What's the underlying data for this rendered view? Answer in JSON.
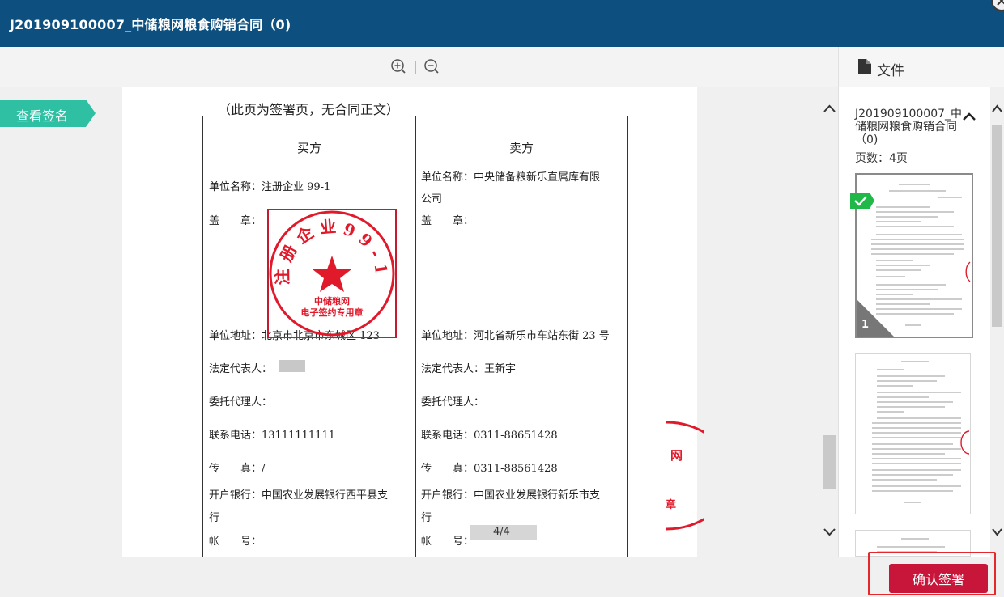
{
  "window": {
    "title": "J201909100007_中储粮网粮食购销合同（0)"
  },
  "toolbar": {
    "zoom_in_icon": "zoom-in-icon",
    "separator": "|",
    "zoom_out_icon": "zoom-out-icon"
  },
  "left_tag": {
    "label": "查看签名",
    "color": "#2fbfa3"
  },
  "document": {
    "heading": "（此页为签署页，无合同正文）",
    "buyer": {
      "header": "买方",
      "name": "单位名称：注册企业 99-1",
      "seal_label": "盖　　章：",
      "address": "单位地址：北京市北京市东城区 123",
      "legal_rep": "法定代表人：",
      "agent": "委托代理人：",
      "phone": "联系电话：13111111111",
      "fax": "传　　真：/",
      "bank_line1": "开户银行：中国农业发展银行西平县支",
      "bank_line2": "行",
      "account": "帐　　号："
    },
    "seller": {
      "header": "卖方",
      "name_line1": "单位名称：中央储备粮新乐直属库有限",
      "name_line2": "公司",
      "seal_label": "盖　　章：",
      "address": "单位地址：河北省新乐市车站东街 23 号",
      "legal_rep": "法定代表人：王新宇",
      "agent": "委托代理人：",
      "phone": "联系电话：0311-88651428",
      "fax": "传　　真：0311-88561428",
      "bank_line1": "开户银行：中国农业发展银行新乐市支",
      "bank_line2": "行",
      "account": "帐　　号："
    },
    "stamp": {
      "ring_text": "注 册 企 业 9 9 - 1",
      "line1": "中储粮网",
      "line2": "电子签约专用章",
      "color": "#e0192b"
    },
    "partial_stamp": {
      "char1": "网",
      "char2": "章"
    },
    "page_indicator": "4/4"
  },
  "sidebar": {
    "header_label": "文件",
    "doc_title": "J201909100007_中储粮网粮食购销合同（0)",
    "page_count": "页数：4页",
    "thumbnails": [
      {
        "number": "1",
        "checked": true
      },
      {
        "number": "",
        "checked": false
      },
      {
        "number": "",
        "checked": false
      }
    ]
  },
  "footer": {
    "confirm_label": "确认签署",
    "confirm_color": "#c8163b"
  }
}
